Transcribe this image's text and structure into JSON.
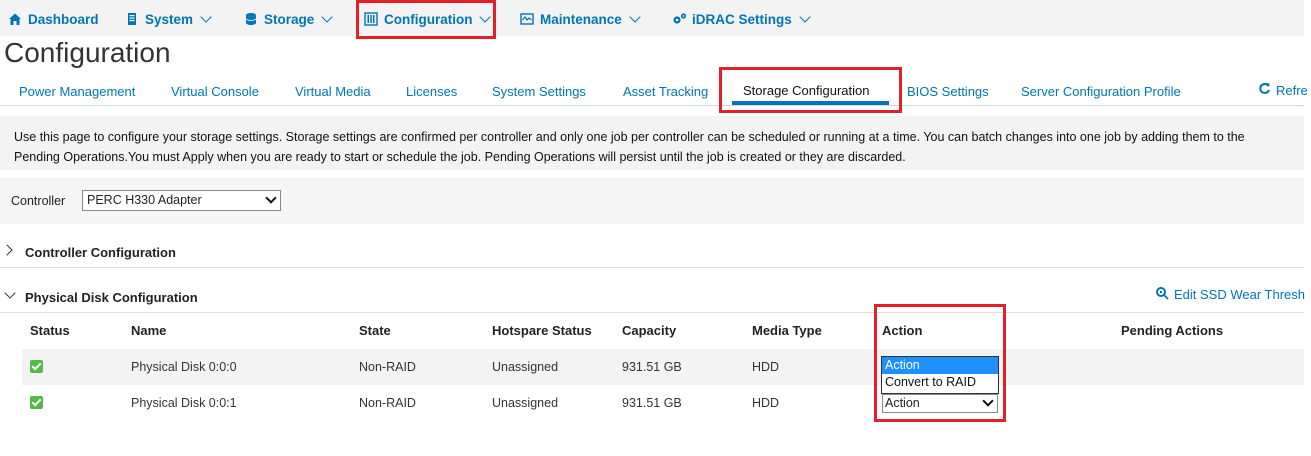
{
  "topnav": {
    "items": [
      {
        "label": "Dashboard",
        "icon": "home-icon",
        "has_dropdown": false
      },
      {
        "label": "System",
        "icon": "server-icon",
        "has_dropdown": true
      },
      {
        "label": "Storage",
        "icon": "database-icon",
        "has_dropdown": true
      },
      {
        "label": "Configuration",
        "icon": "configuration-icon",
        "has_dropdown": true
      },
      {
        "label": "Maintenance",
        "icon": "maintenance-icon",
        "has_dropdown": true
      },
      {
        "label": "iDRAC Settings",
        "icon": "gears-icon",
        "has_dropdown": true
      }
    ]
  },
  "page_title": "Configuration",
  "tabs": [
    {
      "label": "Power Management"
    },
    {
      "label": "Virtual Console"
    },
    {
      "label": "Virtual Media"
    },
    {
      "label": "Licenses"
    },
    {
      "label": "System Settings"
    },
    {
      "label": "Asset Tracking"
    },
    {
      "label": "Storage Configuration",
      "active": true
    },
    {
      "label": "BIOS Settings"
    },
    {
      "label": "Server Configuration Profile"
    }
  ],
  "refresh_label": "Refre",
  "info_text": "Use this page to configure your storage settings. Storage settings are confirmed per controller and only one job per controller can be scheduled or running at a time. You can batch changes into one job by adding them to the Pending Operations.You must Apply when you are ready to start or schedule the job. Pending Operations will persist until the job is created or they are discarded.",
  "controller": {
    "label": "Controller",
    "selected": "PERC H330 Adapter"
  },
  "sections": {
    "controller_config": "Controller Configuration",
    "physical_disk_config": "Physical Disk Configuration",
    "edit_ssd_link": "Edit SSD Wear Thresh"
  },
  "table": {
    "headers": [
      "Status",
      "Name",
      "State",
      "Hotspare Status",
      "Capacity",
      "Media Type",
      "Action",
      "Pending Actions"
    ],
    "rows": [
      {
        "name": "Physical Disk 0:0:0",
        "state": "Non-RAID",
        "hotspare": "Unassigned",
        "capacity": "931.51 GB",
        "media": "HDD",
        "action": "Action"
      },
      {
        "name": "Physical Disk 0:0:1",
        "state": "Non-RAID",
        "hotspare": "Unassigned",
        "capacity": "931.51 GB",
        "media": "HDD",
        "action": "Action"
      }
    ]
  },
  "action_dropdown": {
    "options": [
      "Action",
      "Convert to RAID"
    ],
    "highlighted": "Action"
  },
  "colors": {
    "accent": "#0074b8",
    "highlight_box": "#e0202a",
    "status_ok": "#54b948",
    "selected_option": "#1e90ff"
  }
}
